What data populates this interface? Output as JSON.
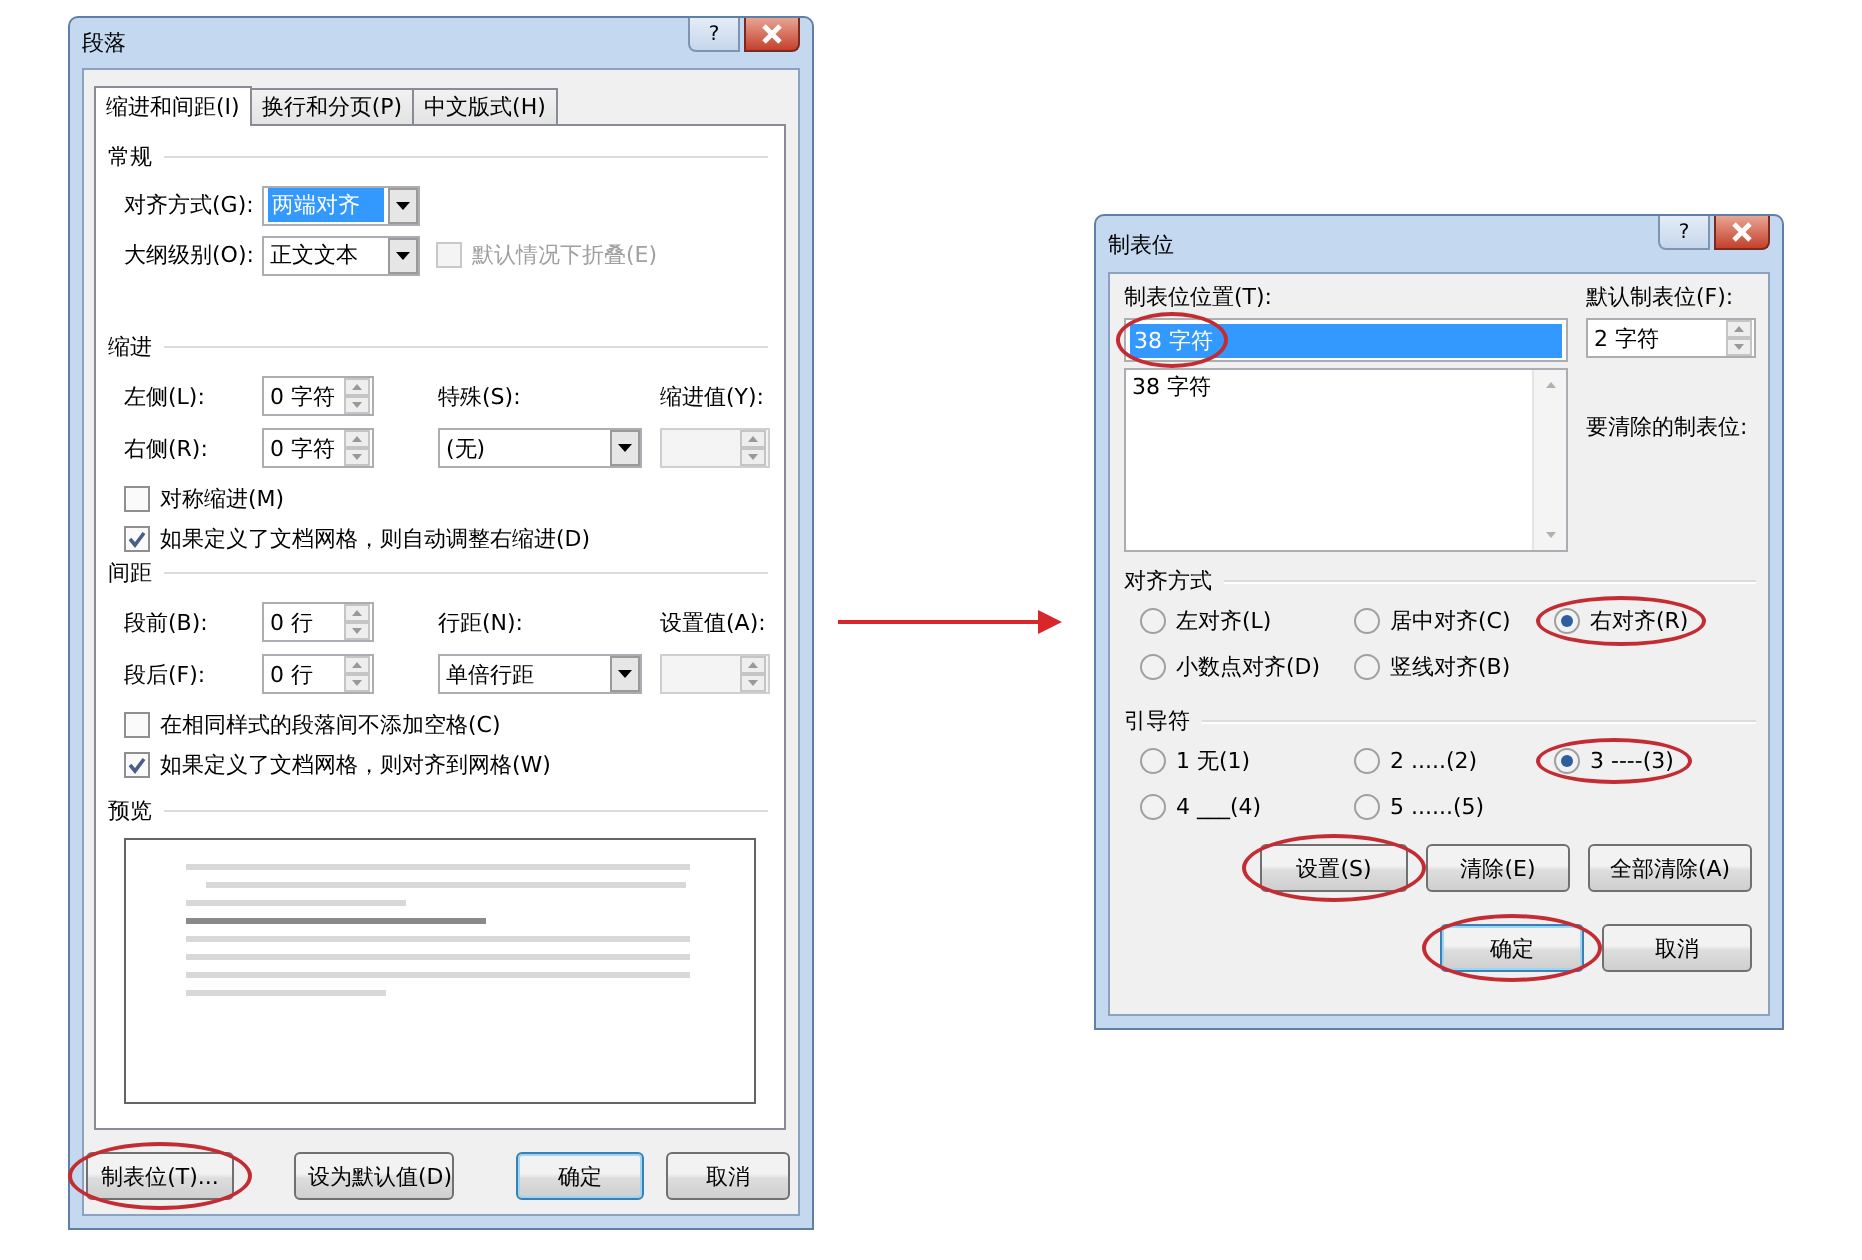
{
  "paragraph_dialog": {
    "title": "段落",
    "help_label": "?",
    "tabs": [
      {
        "label": "缩进和间距(I)",
        "selected": true
      },
      {
        "label": "换行和分页(P)",
        "selected": false
      },
      {
        "label": "中文版式(H)",
        "selected": false
      }
    ],
    "general": {
      "heading": "常规",
      "fields": [
        {
          "label": "对齐方式(G):",
          "value": "两端对齐",
          "highlighted": true
        },
        {
          "label": "大纲级别(O):",
          "value": "正文文本",
          "highlighted": false
        }
      ],
      "collapse_checkbox": {
        "label": "默认情况下折叠(E)",
        "checked": false,
        "disabled": true
      }
    },
    "indent": {
      "heading": "缩进",
      "left": {
        "label": "左侧(L):",
        "value": "0 字符"
      },
      "right": {
        "label": "右侧(R):",
        "value": "0 字符"
      },
      "special": {
        "label": "特殊(S):",
        "value": "(无)"
      },
      "by": {
        "label": "缩进值(Y):"
      },
      "checkboxes": [
        {
          "label": "对称缩进(M)",
          "checked": false,
          "disabled": false
        },
        {
          "label": "如果定义了文档网格，则自动调整右缩进(D)",
          "checked": true,
          "disabled": false
        }
      ]
    },
    "spacing": {
      "heading": "间距",
      "before": {
        "label": "段前(B):",
        "value": "0 行"
      },
      "after": {
        "label": "段后(F):",
        "value": "0 行"
      },
      "line_spacing": {
        "label": "行距(N):",
        "value": "单倍行距"
      },
      "at": {
        "label": "设置值(A):"
      },
      "checkboxes": [
        {
          "label": "在相同样式的段落间不添加空格(C)",
          "checked": false,
          "disabled": false
        },
        {
          "label": "如果定义了文档网格，则对齐到网格(W)",
          "checked": true,
          "disabled": false
        }
      ]
    },
    "preview": {
      "heading": "预览"
    },
    "buttons": [
      {
        "label": "制表位(T)...",
        "circled": true,
        "default": false
      },
      {
        "label": "设为默认值(D)",
        "circled": false,
        "default": false
      },
      {
        "label": "确定",
        "circled": false,
        "default": true
      },
      {
        "label": "取消",
        "circled": false,
        "default": false
      }
    ]
  },
  "tabs_dialog": {
    "title": "制表位",
    "help_label": "?",
    "position": {
      "label": "制表位位置(T):",
      "value": "38 字符",
      "highlighted": true,
      "circled": true
    },
    "list": [
      "38 字符"
    ],
    "default_stop": {
      "label": "默认制表位(F):",
      "value": "2 字符"
    },
    "clear_label": "要清除的制表位:",
    "alignment": {
      "heading": "对齐方式",
      "options": [
        {
          "label": "左对齐(L)",
          "selected": false,
          "circled": false
        },
        {
          "label": "居中对齐(C)",
          "selected": false,
          "circled": false
        },
        {
          "label": "右对齐(R)",
          "selected": true,
          "circled": true
        },
        {
          "label": "小数点对齐(D)",
          "selected": false,
          "circled": false
        },
        {
          "label": "竖线对齐(B)",
          "selected": false,
          "circled": false
        }
      ]
    },
    "leader": {
      "heading": "引导符",
      "options": [
        {
          "label": "1 无(1)",
          "selected": false,
          "circled": false
        },
        {
          "label": "2 .....(2)",
          "selected": false,
          "circled": false
        },
        {
          "label": "3 ----(3)",
          "selected": true,
          "circled": true
        },
        {
          "label": "4 ___(4)",
          "selected": false,
          "circled": false
        },
        {
          "label": "5 ......(5)",
          "selected": false,
          "circled": false
        }
      ]
    },
    "buttons": [
      {
        "label": "设置(S)",
        "circled": true,
        "default": false
      },
      {
        "label": "清除(E)",
        "circled": false,
        "default": false
      },
      {
        "label": "全部清除(A)",
        "circled": false,
        "default": false
      }
    ],
    "footer_buttons": [
      {
        "label": "确定",
        "circled": true,
        "default": true
      },
      {
        "label": "取消",
        "circled": false,
        "default": false
      }
    ]
  }
}
